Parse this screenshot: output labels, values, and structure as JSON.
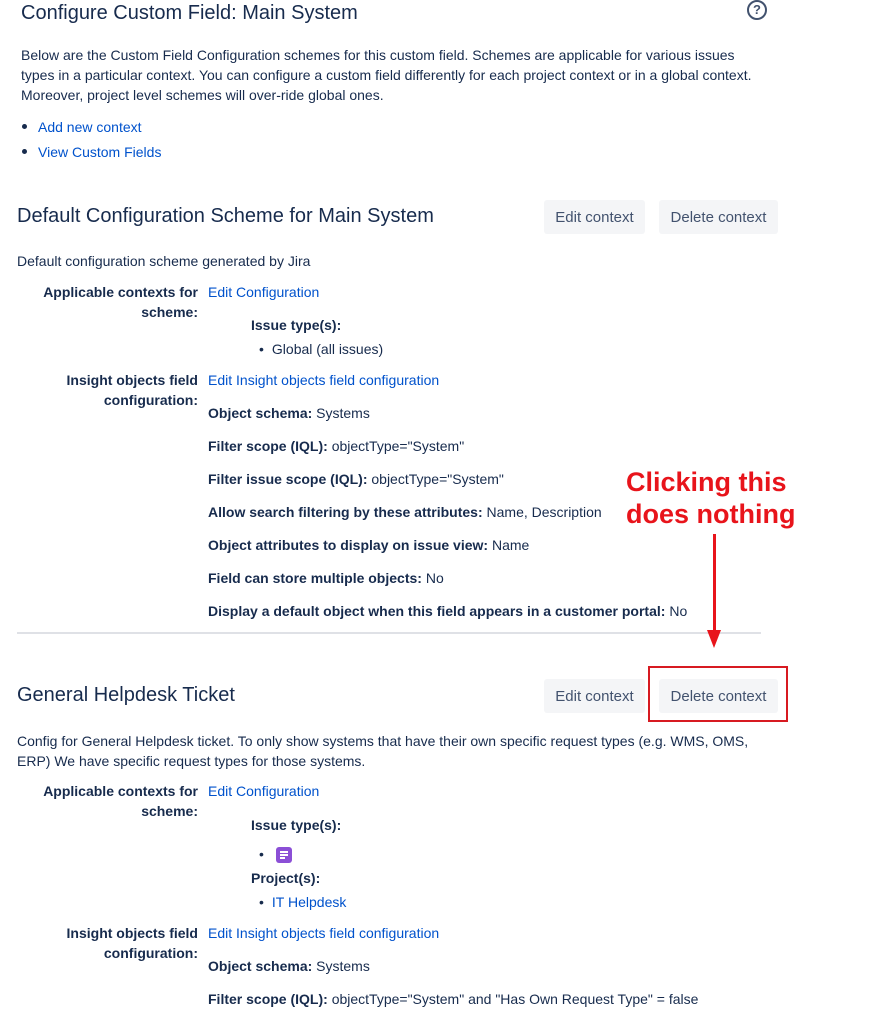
{
  "header": {
    "title": "Configure Custom Field: Main System",
    "help_icon": "question-circle-icon",
    "help_glyph": "?"
  },
  "intro": {
    "text": "Below are the Custom Field Configuration schemes for this custom field. Schemes are applicable for various issues types in a particular context. You can configure a custom field differently for each project context or in a global context. Moreover, project level schemes will over-ride global ones."
  },
  "links": {
    "add_context": "Add new context",
    "view_fields": "View Custom Fields"
  },
  "scheme1": {
    "title": "Default Configuration Scheme for Main System",
    "edit_button": "Edit context",
    "delete_button": "Delete context",
    "description": "Default configuration scheme generated by Jira",
    "contexts_label": "Applicable contexts for scheme:",
    "edit_configuration": "Edit Configuration",
    "issue_types_label": "Issue type(s):",
    "issue_type_value": "Global (all issues)",
    "insight_label": "Insight objects field configuration:",
    "edit_insight": "Edit Insight objects field configuration",
    "rows": [
      {
        "label": "Object schema:",
        "value": "Systems"
      },
      {
        "label": "Filter scope (IQL):",
        "value": "objectType=\"System\""
      },
      {
        "label": "Filter issue scope (IQL):",
        "value": "objectType=\"System\""
      },
      {
        "label": "Allow search filtering by these attributes:",
        "value": "Name, Description"
      },
      {
        "label": "Object attributes to display on issue view:",
        "value": "Name"
      },
      {
        "label": "Field can store multiple objects:",
        "value": "No"
      },
      {
        "label": "Display a default object when this field appears in a customer portal:",
        "value": "No"
      }
    ]
  },
  "annotation": {
    "line1": "Clicking this",
    "line2": "does nothing",
    "color": "#e8141b"
  },
  "scheme2": {
    "title": "General Helpdesk Ticket",
    "edit_button": "Edit context",
    "delete_button": "Delete context",
    "description": "Config for General Helpdesk ticket. To only show systems that have their own specific request types (e.g. WMS, OMS, ERP) We have specific request types for those systems.",
    "contexts_label": "Applicable contexts for scheme:",
    "edit_configuration": "Edit Configuration",
    "issue_types_label": "Issue type(s):",
    "issue_type_icon": "request-type-icon",
    "projects_label": "Project(s):",
    "project_link": "IT Helpdesk",
    "insight_label": "Insight objects field configuration:",
    "edit_insight": "Edit Insight objects field configuration",
    "rows": [
      {
        "label": "Object schema:",
        "value": "Systems"
      },
      {
        "label": "Filter scope (IQL):",
        "value": "objectType=\"System\" and \"Has Own Request Type\" = false"
      }
    ]
  }
}
